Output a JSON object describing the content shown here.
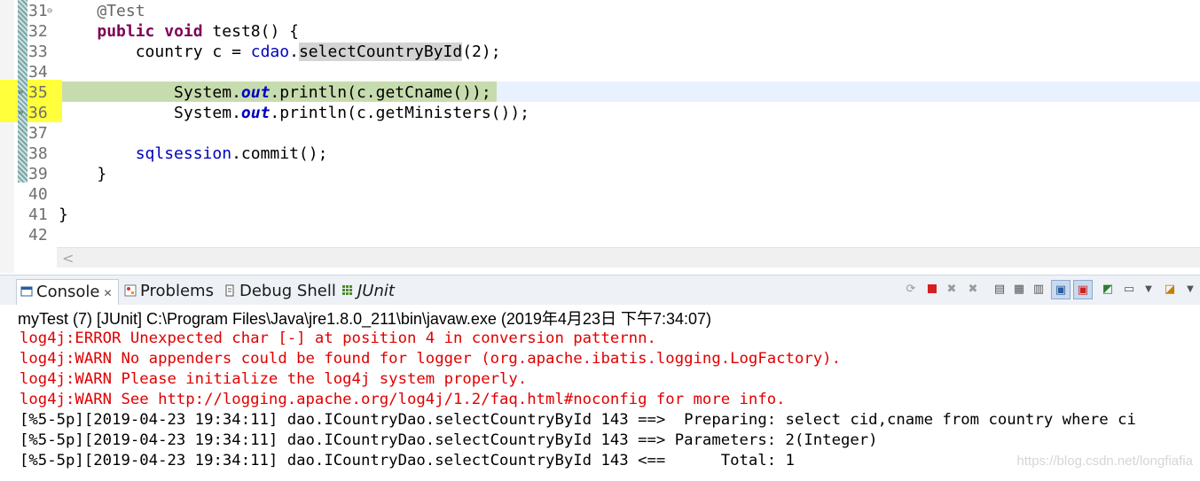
{
  "editor": {
    "lines": [
      {
        "num": "31",
        "parts": [
          {
            "t": "    "
          },
          {
            "t": "@Test",
            "c": "ann"
          }
        ]
      },
      {
        "num": "32",
        "parts": [
          {
            "t": "    "
          },
          {
            "t": "public",
            "c": "kw"
          },
          {
            "t": " "
          },
          {
            "t": "void",
            "c": "kw"
          },
          {
            "t": " test8() {"
          }
        ]
      },
      {
        "num": "33",
        "parts": [
          {
            "t": "        country c = "
          },
          {
            "t": "cdao",
            "c": "fld"
          },
          {
            "t": "."
          },
          {
            "t": "selectCountryById",
            "c": "occ"
          },
          {
            "t": "(2);"
          }
        ]
      },
      {
        "num": "34",
        "parts": []
      },
      {
        "num": "35",
        "parts": [
          {
            "t": "            System."
          },
          {
            "t": "out",
            "c": "sfld"
          },
          {
            "t": ".println(c.getCname());"
          }
        ]
      },
      {
        "num": "36",
        "parts": [
          {
            "t": "            System."
          },
          {
            "t": "out",
            "c": "sfld"
          },
          {
            "t": ".println(c.getMinisters());"
          }
        ]
      },
      {
        "num": "37",
        "parts": []
      },
      {
        "num": "38",
        "parts": [
          {
            "t": "        "
          },
          {
            "t": "sqlsession",
            "c": "fld"
          },
          {
            "t": ".commit();"
          }
        ]
      },
      {
        "num": "39",
        "parts": [
          {
            "t": "    }"
          }
        ]
      },
      {
        "num": "40",
        "parts": []
      },
      {
        "num": "41",
        "parts": [
          {
            "t": "}"
          }
        ]
      },
      {
        "num": "42",
        "parts": []
      }
    ],
    "fold_marker": "⊖",
    "scroll_left": "<"
  },
  "tabs": {
    "console": "Console",
    "console_close": "✕",
    "problems": "Problems",
    "debug_shell": "Debug Shell",
    "junit": "JUnit"
  },
  "console": {
    "process": "myTest (7) [JUnit] C:\\Program Files\\Java\\jre1.8.0_211\\bin\\javaw.exe (2019年4月23日 下午7:34:07)",
    "lines": [
      {
        "text": "log4j:ERROR Unexpected char [-] at position 4 in conversion patternn.",
        "kind": "err"
      },
      {
        "text": "log4j:WARN No appenders could be found for logger (org.apache.ibatis.logging.LogFactory).",
        "kind": "err"
      },
      {
        "text": "log4j:WARN Please initialize the log4j system properly.",
        "kind": "err"
      },
      {
        "text": "log4j:WARN See http://logging.apache.org/log4j/1.2/faq.html#noconfig for more info.",
        "kind": "err"
      },
      {
        "text": "[%5-5p][2019-04-23 19:34:11] dao.ICountryDao.selectCountryById 143 ==>  Preparing: select cid,cname from country where ci",
        "kind": "std"
      },
      {
        "text": "[%5-5p][2019-04-23 19:34:11] dao.ICountryDao.selectCountryById 143 ==> Parameters: 2(Integer)",
        "kind": "std"
      },
      {
        "text": "[%5-5p][2019-04-23 19:34:11] dao.ICountryDao.selectCountryById 143 <==      Total: 1",
        "kind": "std"
      }
    ]
  },
  "watermark": "https://blog.csdn.net/longfiafia"
}
